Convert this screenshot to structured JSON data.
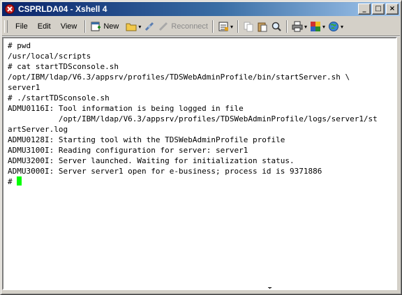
{
  "window": {
    "title": "CSPRLDA04 - Xshell 4",
    "min_label": "_",
    "max_label": "□",
    "close_label": "×"
  },
  "menu": {
    "file": "File",
    "edit": "Edit",
    "view": "View"
  },
  "toolbar": {
    "new_label": "New",
    "reconnect_label": "Reconnect",
    "dropdown_glyph": "▾"
  },
  "terminal": {
    "lines": [
      "# pwd",
      "/usr/local/scripts",
      "# cat startTDSconsole.sh",
      "/opt/IBM/ldap/V6.3/appsrv/profiles/TDSWebAdminProfile/bin/startServer.sh \\",
      "server1",
      "# ./startTDSconsole.sh",
      "ADMU0116I: Tool information is being logged in file",
      "           /opt/IBM/ldap/V6.3/appsrv/profiles/TDSWebAdminProfile/logs/server1/st",
      "artServer.log",
      "ADMU0128I: Starting tool with the TDSWebAdminProfile profile",
      "ADMU3100I: Reading configuration for server: server1",
      "ADMU3200I: Server launched. Waiting for initialization status.",
      "ADMU3000I: Server server1 open for e-business; process id is 9371886"
    ],
    "prompt": "# ",
    "cursor_color": "#00ff00"
  },
  "colors": {
    "titlebar_start": "#0a246a",
    "titlebar_end": "#a6caf0",
    "chrome": "#d4d0c8"
  },
  "icons": [
    "xshell-icon",
    "new-session-icon",
    "open-folder-icon",
    "connect-icon",
    "reconnect-icon",
    "properties-icon",
    "copy-icon",
    "paste-icon",
    "find-icon",
    "print-icon",
    "transfer-icon",
    "globe-icon"
  ]
}
